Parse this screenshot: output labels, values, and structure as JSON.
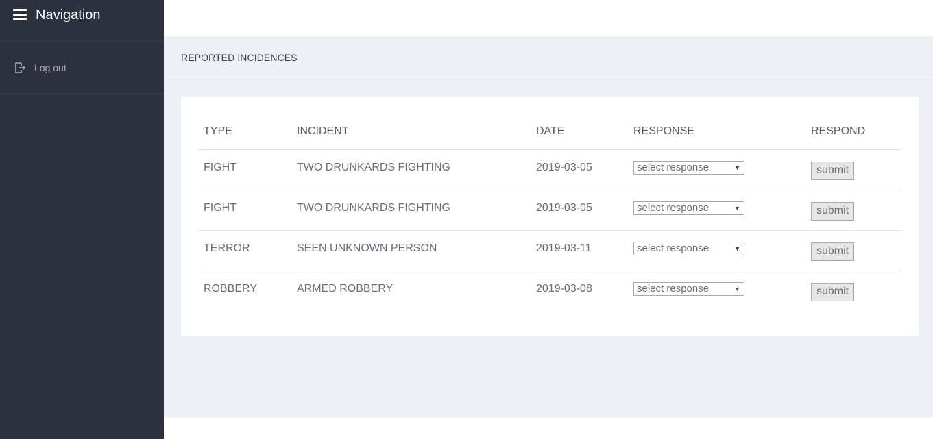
{
  "sidebar": {
    "title": "Navigation",
    "items": [
      {
        "label": "Log out",
        "icon": "logout-icon"
      }
    ]
  },
  "main": {
    "section_title": "REPORTED INCIDENCES",
    "table": {
      "headers": [
        "TYPE",
        "INCIDENT",
        "DATE",
        "RESPONSE",
        "RESPOND"
      ],
      "rows": [
        {
          "type": "FIGHT",
          "incident": "TWO DRUNKARDS FIGHTING",
          "date": "2019-03-05",
          "response": "select response",
          "button": "submit"
        },
        {
          "type": "FIGHT",
          "incident": "TWO DRUNKARDS FIGHTING",
          "date": "2019-03-05",
          "response": "select response",
          "button": "submit"
        },
        {
          "type": "TERROR",
          "incident": "SEEN UNKNOWN PERSON",
          "date": "2019-03-11",
          "response": "select response",
          "button": "submit"
        },
        {
          "type": "ROBBERY",
          "incident": "ARMED ROBBERY",
          "date": "2019-03-08",
          "response": "select response",
          "button": "submit"
        }
      ]
    }
  },
  "colors": {
    "sidebar_bg": "#2e313e",
    "content_bg": "#edf0f4",
    "card_bg": "#ffffff"
  }
}
